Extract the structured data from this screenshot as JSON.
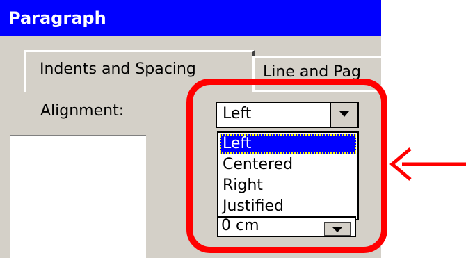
{
  "window": {
    "title": "Paragraph"
  },
  "tabs": [
    {
      "label": "Indents and Spacing",
      "active": true
    },
    {
      "label": "Line and Pag",
      "active": false
    }
  ],
  "alignment": {
    "label": "Alignment:",
    "selected_value": "Left",
    "options": [
      "Left",
      "Centered",
      "Right",
      "Justified"
    ],
    "highlighted_option": "Left"
  },
  "spacing": {
    "value": "0 cm"
  },
  "annotation": {
    "color": "#ff0000"
  },
  "colors": {
    "titlebar": "#0000ff",
    "dialog": "#d4d0c8",
    "selection": "#0000ff"
  }
}
